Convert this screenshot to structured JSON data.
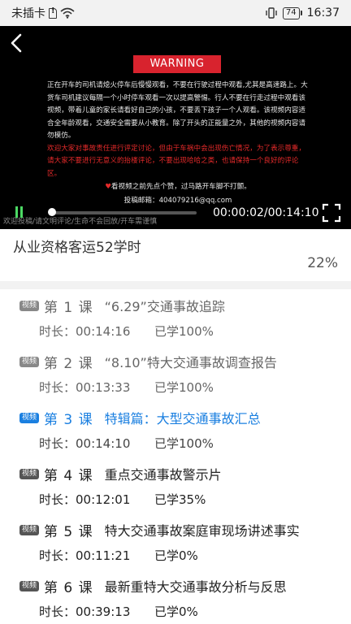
{
  "status_bar": {
    "carrier": "未插卡",
    "battery": "74",
    "time": "16:37"
  },
  "player": {
    "warning": "WARNING",
    "notice_white": "正在开车的司机请熄火停车后慢慢观看，不要在行驶过程中观看,尤其是高速路上。大货车司机建议每隔一个小时停车观看一次以提高警惕。行人不要在行走过程中观看该视频，带着儿童的家长请看好自己的小孩，不要丢下孩子一个人观看。该视频内容适合全年龄观看，交通安全需要从小教育。除了开头的正能量之外，其他的视频内容请勿模仿。",
    "notice_red": "欢迎大家对事故责任进行评定讨论，但由于车祸中会出现伤亡情况，为了表示尊重，请大家不要进行无意义的抬楼评论，不要出现哈哈之类，也请保持一个良好的评论区。",
    "like_prompt": "看视频之前先点个赞，过马路开车脚不打颤。",
    "submit_email": "投稿邮箱：404079216@qq.com",
    "scroll_text": "欢迎投稿/请文明评论/生命不会回放/开车需谨慎",
    "time_readout": "00:00:02/00:14:10",
    "progress_fraction": 0.0024
  },
  "course": {
    "title": "从业资格客运52学时",
    "progress": "22%"
  },
  "lessons": [
    {
      "tag": "视频",
      "num": "第 1 课",
      "name": "“6.29”交通事故追踪",
      "duration": "时长：00:14:16",
      "studied": "已学100%",
      "state": "done"
    },
    {
      "tag": "视频",
      "num": "第 2 课",
      "name": "“8.10”特大交通事故调查报告",
      "duration": "时长：00:13:33",
      "studied": "已学100%",
      "state": "done"
    },
    {
      "tag": "视频",
      "num": "第 3 课",
      "name": "特辑篇：大型交通事故汇总",
      "duration": "时长：00:14:10",
      "studied": "已学100%",
      "state": "active"
    },
    {
      "tag": "视频",
      "num": "第 4 课",
      "name": "重点交通事故警示片",
      "duration": "时长：00:12:01",
      "studied": "已学35%",
      "state": "new"
    },
    {
      "tag": "视频",
      "num": "第 5 课",
      "name": "特大交通事故案庭审现场讲述事实",
      "duration": "时长：00:11:21",
      "studied": "已学0%",
      "state": "new"
    },
    {
      "tag": "视频",
      "num": "第 6 课",
      "name": "最新重特大交通事故分析与反思",
      "duration": "时长：00:39:13",
      "studied": "已学0%",
      "state": "new"
    }
  ],
  "colors": {
    "accent": "#1a7fe0",
    "warning": "#d8232e",
    "play_indicator": "#4cd964"
  }
}
